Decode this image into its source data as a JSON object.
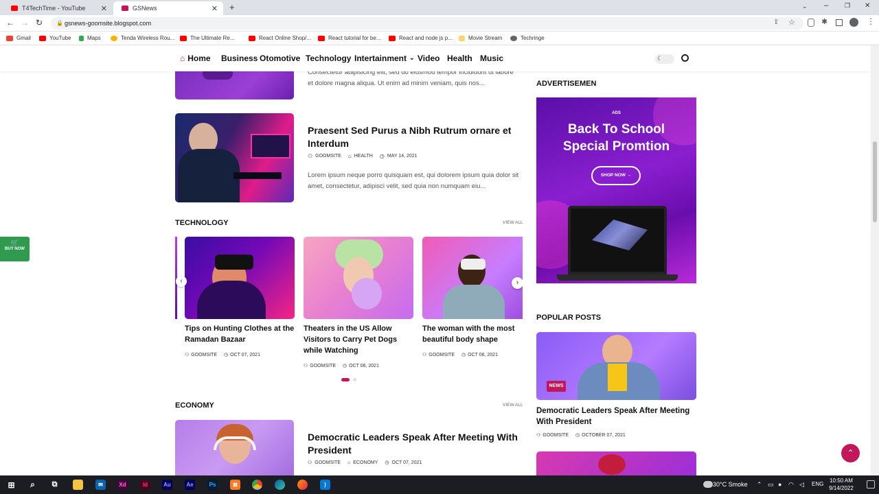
{
  "browser": {
    "tabs": [
      {
        "title": "T4TechTime - YouTube",
        "color": "#ff0000"
      },
      {
        "title": "GSNews",
        "color": "#c2185b"
      }
    ],
    "url": "gsnews-goomsite.blogspot.com",
    "bookmarks": [
      {
        "label": "Gmail",
        "color": "#ea4335"
      },
      {
        "label": "YouTube",
        "color": "#ff0000"
      },
      {
        "label": "Maps",
        "color": "#34a853"
      },
      {
        "label": "Tenda Wireless Rou...",
        "color": "#f4b400"
      },
      {
        "label": "The Ultimate Re...",
        "color": "#ff0000"
      },
      {
        "label": "React Online Shop/...",
        "color": "#ff0000"
      },
      {
        "label": "React tutorial for be...",
        "color": "#ff0000"
      },
      {
        "label": "React and node js p...",
        "color": "#ff0000"
      },
      {
        "label": "Movie Stream",
        "color": "#f7d774"
      },
      {
        "label": "Techringe",
        "color": "#666666"
      }
    ]
  },
  "nav": {
    "items": [
      "Home",
      "Business",
      "Otomotive",
      "Technology",
      "Intertainment",
      "Video",
      "Health",
      "Music"
    ],
    "accent": "#c2185b"
  },
  "top_post": {
    "excerpt": "Consectetur adipisicing elit, sed do eiusmod tempor incididunt ut labore et dolore magna aliqua. Ut enim ad minim veniam, quis nos..."
  },
  "post2": {
    "title": "Praesent Sed Purus a Nibh Rutrum ornare et Interdum",
    "author": "GOOMSITE",
    "category": "HEALTH",
    "date": "MAY 14, 2021",
    "excerpt": "Lorem ipsum neque porro quisquam est, qui dolorem ipsum quia dolor sit amet, consectetur, adipisci velit, sed quia non numquam eiu..."
  },
  "technology": {
    "heading": "TECHNOLOGY",
    "view_all": "VIEW ALL",
    "cards": [
      {
        "title": "Tips on Hunting Clothes at the Ramadan Bazaar",
        "author": "GOOMSITE",
        "date": "OCT 07, 2021"
      },
      {
        "title": "Theaters in the US Allow Visitors to Carry Pet Dogs while Watching",
        "author": "GOOMSITE",
        "date": "OCT 06, 2021"
      },
      {
        "title": "The woman with the most beautiful body shape",
        "author": "GOOMSITE",
        "date": "OCT 06, 2021"
      }
    ]
  },
  "economy": {
    "heading": "ECONOMY",
    "view_all": "VIEW ALL",
    "post": {
      "title": "Democratic Leaders Speak After Meeting With President",
      "author": "GOOMSITE",
      "category": "ECONOMY",
      "date": "OCT 07, 2021"
    }
  },
  "buy_now": "BUY NOW",
  "sidebar": {
    "ads_heading": "ADVERTISEMEN",
    "ad": {
      "tag": "ADS",
      "line1": "Back To School",
      "line2": "Special Promtion",
      "cta": "SHOP NOW →"
    },
    "popular_heading": "POPULAR POSTS",
    "popular": {
      "badge": "NEWS",
      "title": "Democratic Leaders Speak After Meeting With President",
      "author": "GOOMSITE",
      "date": "OCTOBER 07, 2021"
    }
  },
  "taskbar": {
    "weather": "30°C  Smoke",
    "lang": "ENG",
    "time": "10:50 AM",
    "date": "9/14/2022"
  }
}
